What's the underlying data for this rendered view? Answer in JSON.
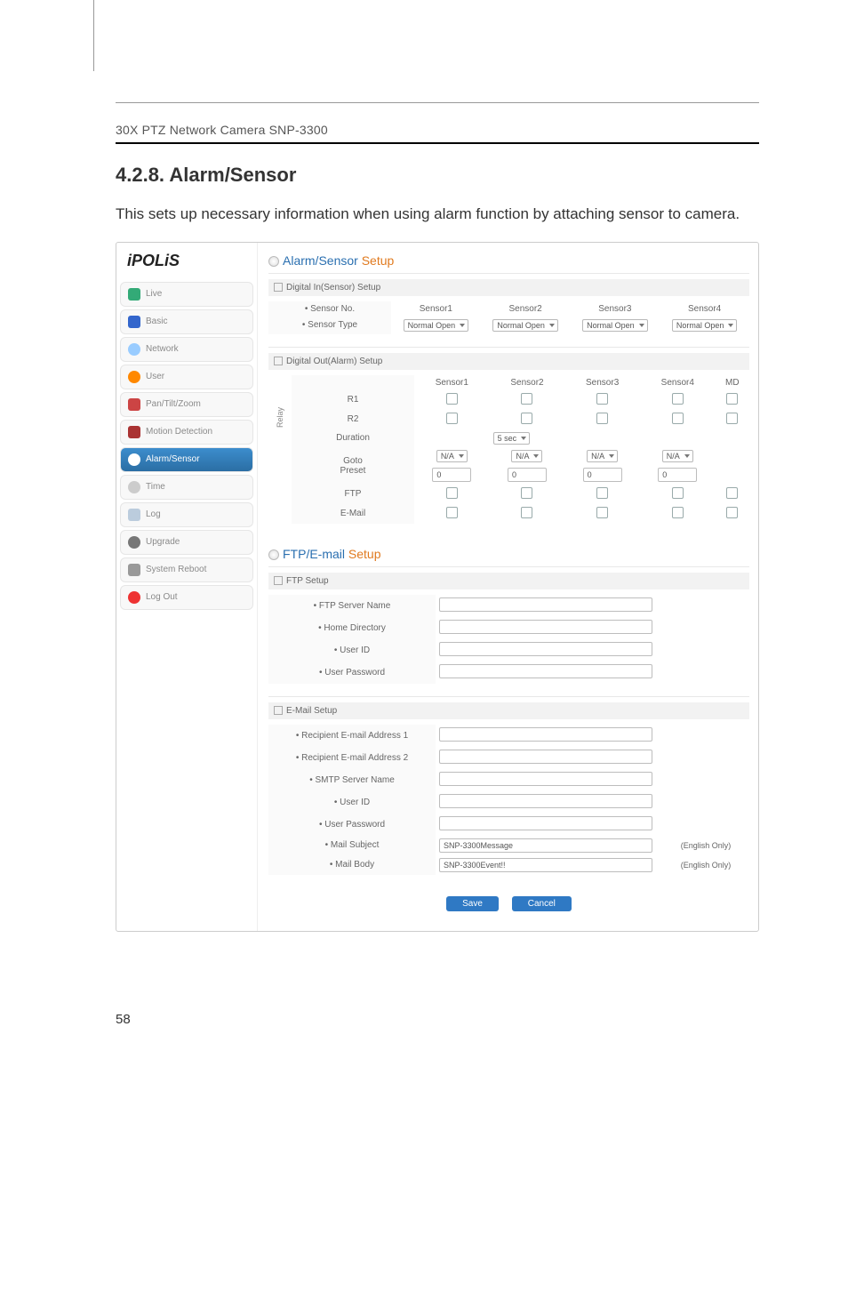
{
  "doc": {
    "header": "30X PTZ Network Camera SNP-3300",
    "section_no": "4.2.8. Alarm/Sensor",
    "intro": "This sets up necessary information when using alarm function by attaching sensor to camera.",
    "page_number": "58"
  },
  "logo": "iPOLiS",
  "nav": {
    "live": "Live",
    "basic": "Basic",
    "network": "Network",
    "user": "User",
    "ptz": "Pan/Tilt/Zoom",
    "motion": "Motion Detection",
    "alarm": "Alarm/Sensor",
    "time": "Time",
    "log": "Log",
    "upgrade": "Upgrade",
    "reboot": "System Reboot",
    "logout": "Log Out"
  },
  "titles": {
    "alarm_a": "Alarm/Sensor ",
    "alarm_b": "Setup",
    "ftp_a": "FTP/E-mail ",
    "ftp_b": "Setup"
  },
  "panels": {
    "digin": "Digital In(Sensor) Setup",
    "digout": "Digital Out(Alarm) Setup",
    "ftp": "FTP Setup",
    "email": "E-Mail Setup"
  },
  "digin": {
    "sensor_no": "• Sensor No.",
    "sensor_type": "• Sensor Type",
    "cols": {
      "s1": "Sensor1",
      "s2": "Sensor2",
      "s3": "Sensor3",
      "s4": "Sensor4"
    },
    "type_val": "Normal Open"
  },
  "digout": {
    "cols": {
      "s1": "Sensor1",
      "s2": "Sensor2",
      "s3": "Sensor3",
      "s4": "Sensor4",
      "md": "MD"
    },
    "relay_side": "Relay",
    "r1": "R1",
    "r2": "R2",
    "duration": "Duration",
    "duration_val": "5 sec",
    "goto": "Goto\nPreset",
    "goto_sel": "N/A",
    "goto_val": "0",
    "ftp": "FTP",
    "email": "E-Mail"
  },
  "ftp": {
    "server": "• FTP Server Name",
    "home": "• Home Directory",
    "uid": "• User ID",
    "pwd": "• User Password"
  },
  "email": {
    "r1": "• Recipient E-mail Address 1",
    "r2": "• Recipient E-mail Address 2",
    "smtp": "• SMTP Server Name",
    "uid": "• User ID",
    "pwd": "• User Password",
    "subj": "• Mail Subject",
    "subj_val": "SNP-3300Message",
    "body": "• Mail Body",
    "body_val": "SNP-3300Event!!",
    "note": "(English Only)"
  },
  "buttons": {
    "save": "Save",
    "cancel": "Cancel"
  }
}
